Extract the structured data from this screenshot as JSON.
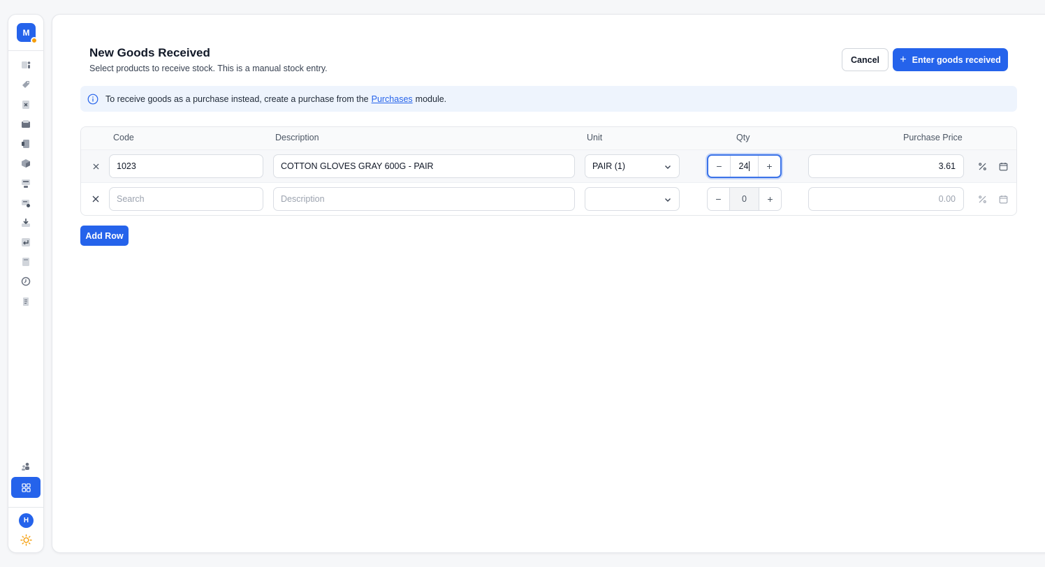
{
  "sidebar": {
    "logo_letter": "M",
    "user_initial": "H",
    "nav_icons": [
      "dashboard-icon",
      "tag-icon",
      "document-x-icon",
      "inbox-icon",
      "receipt-icon",
      "box-icon",
      "register-icon",
      "ticket-icon",
      "download-icon",
      "return-icon",
      "calculator-icon",
      "clock-icon",
      "report-icon"
    ],
    "bottom_icons": [
      "users-icon",
      "grid-icon",
      "sun-icon"
    ]
  },
  "header": {
    "title": "New Goods Received",
    "subtitle": "Select products to receive stock. This is a manual stock entry.",
    "cancel_label": "Cancel",
    "primary_label": "Enter goods received"
  },
  "banner": {
    "text_before": "To receive goods as a purchase instead, create a purchase from the",
    "link_text": "Purchases",
    "text_after": "module."
  },
  "table": {
    "columns": {
      "code": "Code",
      "description": "Description",
      "unit": "Unit",
      "qty": "Qty",
      "purchase_price": "Purchase Price"
    },
    "rows": [
      {
        "code": "1023",
        "description": "COTTON GLOVES GRAY 600G - PAIR",
        "unit": "PAIR (1)",
        "qty": "24",
        "purchase_price": "3.61"
      },
      {
        "code_placeholder": "Search",
        "description_placeholder": "Description",
        "unit": "",
        "qty": "0",
        "purchase_price_placeholder": "0.00"
      }
    ]
  },
  "add_row_label": "Add Row",
  "colors": {
    "accent": "#2563eb",
    "banner_bg": "#eef4fd",
    "status_dot": "#f59e0b"
  }
}
